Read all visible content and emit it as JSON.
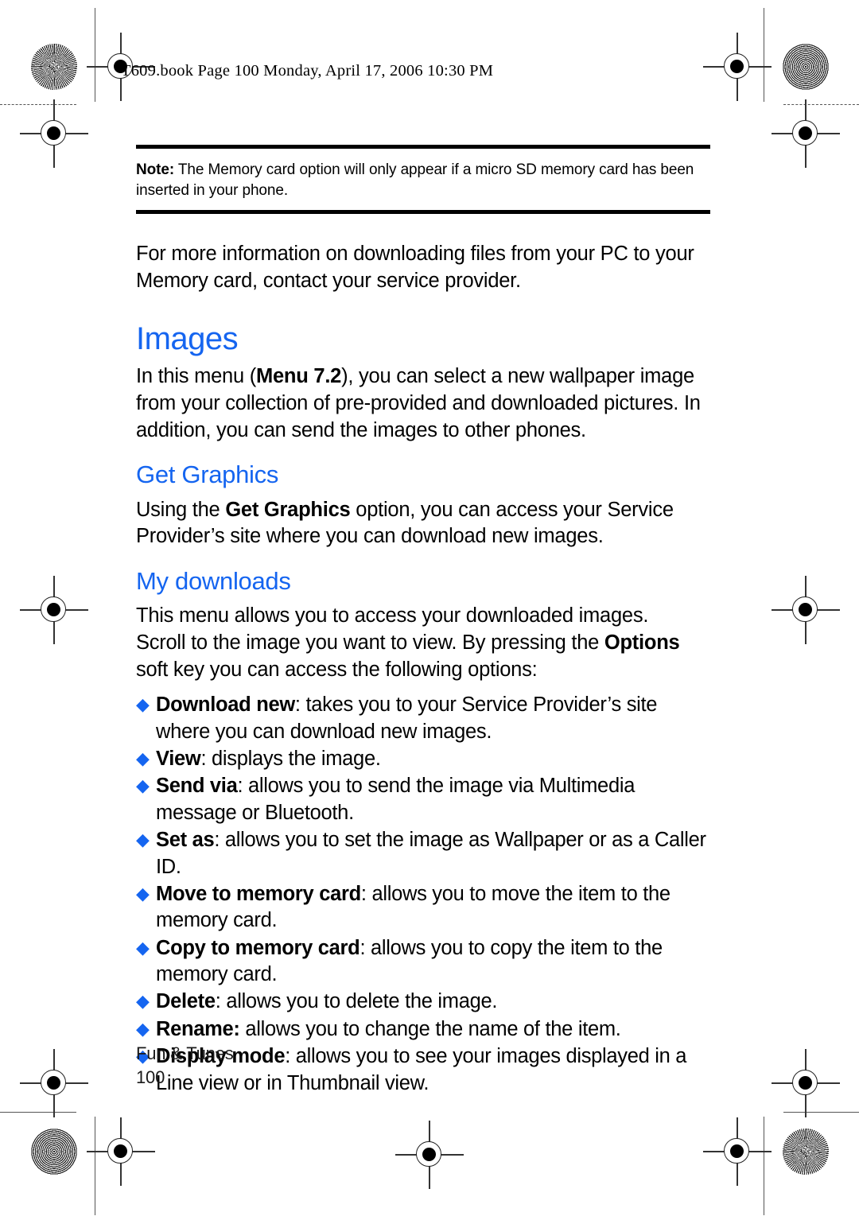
{
  "page": {
    "running_header": "T609.book  Page 100  Monday, April 17, 2006  10:30 PM",
    "accent_color": "#1565f0",
    "text_color": "#000000"
  },
  "note": {
    "label": "Note:",
    "text": " The Memory card option will only appear if a micro SD memory card has been inserted in your phone."
  },
  "intro_paragraph": "For more information on downloading files from your PC to your Memory card, contact your service provider.",
  "sections": {
    "images": {
      "heading": "Images",
      "paragraph_part1": "In this menu (",
      "paragraph_bold": "Menu 7.2",
      "paragraph_part2": "), you can select a new wallpaper image from your collection of pre-provided and downloaded pictures. In addition, you can send the images to other phones."
    },
    "get_graphics": {
      "heading": "Get Graphics",
      "paragraph_part1": "Using the ",
      "paragraph_bold": "Get Graphics",
      "paragraph_part2": " option, you can access your Service Provider’s site where you can download new images."
    },
    "my_downloads": {
      "heading": "My downloads",
      "paragraph1": "This menu allows you to access your downloaded images.",
      "paragraph2_part1": "Scroll to the image you want to view. By pressing the ",
      "paragraph2_bold": "Options",
      "paragraph2_part2": " soft key you can access the following options:"
    }
  },
  "options_list": {
    "bullet_glyph": "◆",
    "items": [
      {
        "label": "Download new",
        "description": ": takes you to your Service Provider’s site where you can download new images."
      },
      {
        "label": "View",
        "description": ": displays the image."
      },
      {
        "label": "Send via",
        "description": ": allows you to send the image via Multimedia message or Bluetooth."
      },
      {
        "label": "Set as",
        "description": ": allows you to set the image as Wallpaper or as a Caller ID."
      },
      {
        "label": "Move to memory card",
        "description": ": allows you to move the item to the memory card."
      },
      {
        "label": "Copy to memory card",
        "description": ": allows you to copy the item to the memory card."
      },
      {
        "label": "Delete",
        "description": ": allows you to delete the image."
      },
      {
        "label": "Rename:",
        "description": " allows you to change the name of the item."
      },
      {
        "label": "Display mode",
        "description": ": allows you to see your images displayed in a Line view or in Thumbnail view."
      }
    ]
  },
  "footer": {
    "chapter": "Fun & Tunes",
    "page_number": "100"
  }
}
